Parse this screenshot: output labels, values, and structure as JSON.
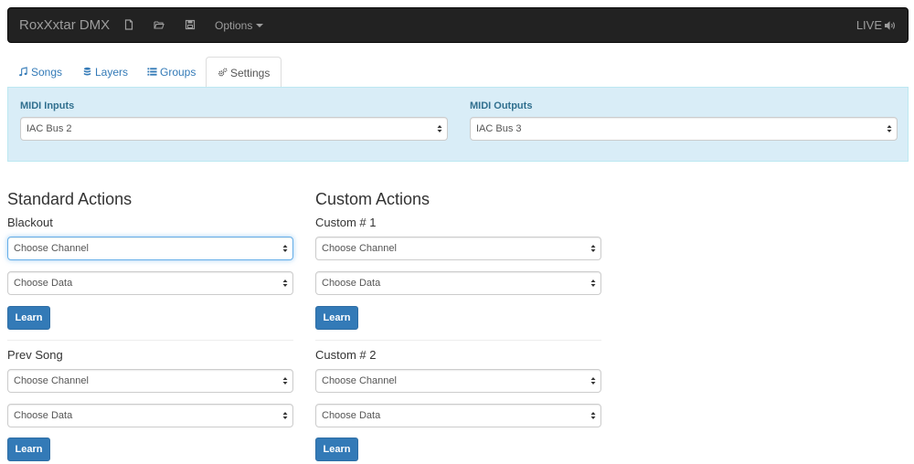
{
  "navbar": {
    "brand": "RoxXxtar DMX",
    "icons": [
      "new-file-icon",
      "open-folder-icon",
      "save-icon"
    ],
    "options_label": "Options",
    "live_label": "LIVE"
  },
  "tabs": [
    {
      "label": "Songs",
      "icon": "music-icon"
    },
    {
      "label": "Layers",
      "icon": "layers-icon"
    },
    {
      "label": "Groups",
      "icon": "list-icon"
    },
    {
      "label": "Settings",
      "icon": "cogs-icon",
      "active": true
    }
  ],
  "midi": {
    "inputs_label": "MIDI Inputs",
    "inputs_value": "IAC Bus 2",
    "outputs_label": "MIDI Outputs",
    "outputs_value": "IAC Bus 3"
  },
  "standard": {
    "title": "Standard Actions",
    "actions": [
      {
        "label": "Blackout",
        "channel": "Choose Channel",
        "data": "Choose Data",
        "learn": "Learn"
      },
      {
        "label": "Prev Song",
        "channel": "Choose Channel",
        "data": "Choose Data",
        "learn": "Learn"
      }
    ]
  },
  "custom": {
    "title": "Custom Actions",
    "actions": [
      {
        "label": "Custom # 1",
        "channel": "Choose Channel",
        "data": "Choose Data",
        "learn": "Learn"
      },
      {
        "label": "Custom # 2",
        "channel": "Choose Channel",
        "data": "Choose Data",
        "learn": "Learn"
      }
    ]
  },
  "colors": {
    "navbar_bg": "#222222",
    "link": "#337ab7",
    "info_panel_bg": "#d9edf7",
    "info_text": "#31708f",
    "primary_button": "#337ab7"
  }
}
